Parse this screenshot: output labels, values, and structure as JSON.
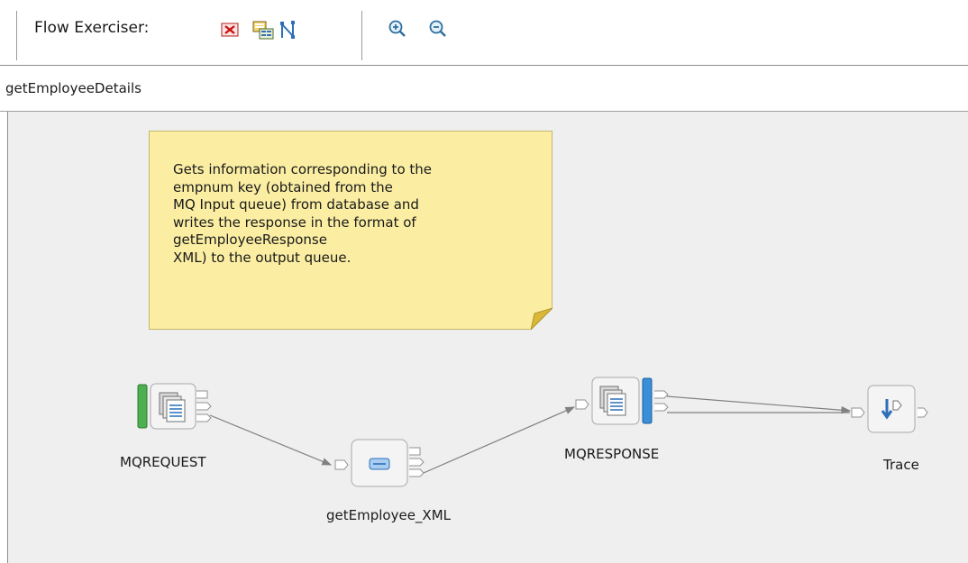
{
  "toolbar": {
    "label": "Flow Exerciser:",
    "icons": [
      "stop-recording-icon",
      "view-message-icon",
      "path-icon",
      "zoom-in-icon",
      "zoom-out-icon"
    ]
  },
  "flow": {
    "title": "getEmployeeDetails",
    "note": "Gets information corresponding to the\nempnum key (obtained from the\nMQ Input queue) from database and\nwrites the response in the format of\ngetEmployeeResponse\nXML) to the output queue.",
    "nodes": {
      "mqrequest": "MQREQUEST",
      "compute": "getEmployee_XML",
      "mqresponse": "MQRESPONSE",
      "trace": "Trace"
    }
  },
  "colors": {
    "canvas": "#efefef",
    "note": "#fbeea3",
    "input_bar": "#4caf50",
    "output_bar": "#3a8fd8"
  }
}
